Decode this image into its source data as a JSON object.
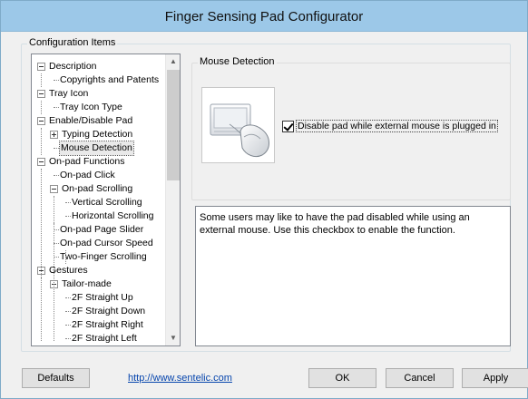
{
  "window": {
    "title": "Finger Sensing Pad Configurator"
  },
  "config": {
    "legend": "Configuration Items",
    "tree": [
      {
        "label": "Description",
        "level": 0,
        "expander": "minus"
      },
      {
        "label": "Copyrights and Patents",
        "level": 1
      },
      {
        "label": "Tray Icon",
        "level": 0,
        "expander": "minus"
      },
      {
        "label": "Tray Icon Type",
        "level": 1
      },
      {
        "label": "Enable/Disable Pad",
        "level": 0,
        "expander": "minus"
      },
      {
        "label": "Typing Detection",
        "level": 1,
        "expander": "plus"
      },
      {
        "label": "Mouse Detection",
        "level": 1,
        "selected": true
      },
      {
        "label": "On-pad Functions",
        "level": 0,
        "expander": "minus"
      },
      {
        "label": "On-pad Click",
        "level": 1
      },
      {
        "label": "On-pad Scrolling",
        "level": 1,
        "expander": "minus"
      },
      {
        "label": "Vertical Scrolling",
        "level": 2
      },
      {
        "label": "Horizontal Scrolling",
        "level": 2
      },
      {
        "label": "On-pad Page Slider",
        "level": 1
      },
      {
        "label": "On-pad Cursor Speed",
        "level": 1
      },
      {
        "label": "Two-Finger Scrolling",
        "level": 1
      },
      {
        "label": "Gestures",
        "level": 0,
        "expander": "minus"
      },
      {
        "label": "Tailor-made",
        "level": 1,
        "expander": "minus"
      },
      {
        "label": "2F Straight Up",
        "level": 2
      },
      {
        "label": "2F Straight Down",
        "level": 2
      },
      {
        "label": "2F Straight Right",
        "level": 2
      },
      {
        "label": "2F Straight Left",
        "level": 2
      }
    ]
  },
  "mouse_detection": {
    "legend": "Mouse Detection",
    "checkbox_label": "Disable pad while external mouse is plugged in",
    "checked": true,
    "description": "Some users may like to have the pad disabled while using an external mouse. Use this checkbox to enable the function."
  },
  "buttons": {
    "defaults": "Defaults",
    "ok": "OK",
    "cancel": "Cancel",
    "apply": "Apply"
  },
  "link": "http://www.sentelic.com",
  "icons": {
    "expander_minus": "minus-box-icon",
    "expander_plus": "plus-box-icon",
    "scroll_up": "chevron-up-icon",
    "scroll_down": "chevron-down-icon",
    "illustration": "touchpad-mouse-icon"
  }
}
